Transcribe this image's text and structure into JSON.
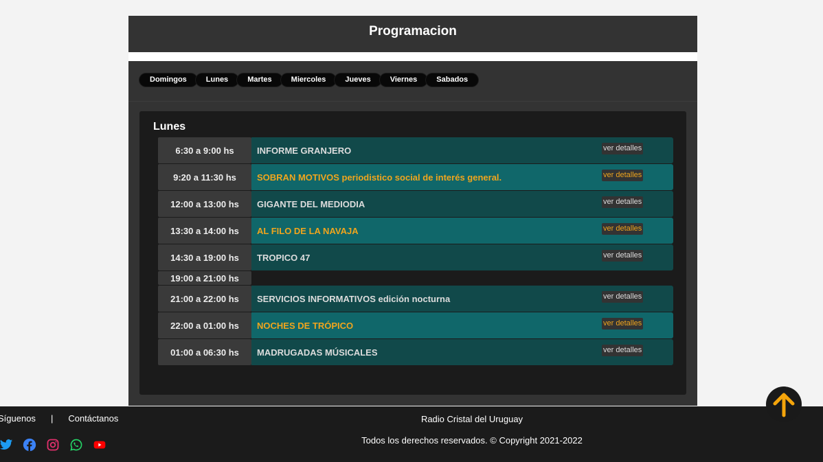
{
  "header": {
    "title": "Programacion"
  },
  "tabs": [
    {
      "label": "Domingos"
    },
    {
      "label": "Lunes"
    },
    {
      "label": "Martes"
    },
    {
      "label": "Miercoles"
    },
    {
      "label": "Jueves"
    },
    {
      "label": "Viernes"
    },
    {
      "label": "Sabados"
    }
  ],
  "day": {
    "title": "Lunes",
    "details_label": "ver detalles",
    "rows": [
      {
        "time": "6:30 a 9:00 hs",
        "program": "INFORME GRANJERO"
      },
      {
        "time": "9:20 a 11:30 hs",
        "program": "SOBRAN MOTIVOS periodistico social de interés general."
      },
      {
        "time": "12:00 a 13:00 hs",
        "program": "GIGANTE DEL MEDIODIA"
      },
      {
        "time": "13:30 a 14:00 hs",
        "program": "AL FILO DE LA NAVAJA"
      },
      {
        "time": "14:30 a 19:00 hs",
        "program": "TROPICO 47"
      },
      {
        "time": "19:00 a 21:00 hs",
        "program": ""
      },
      {
        "time": "21:00 a 22:00 hs",
        "program": "SERVICIOS INFORMATIVOS edición nocturna"
      },
      {
        "time": "22:00 a 01:00 hs",
        "program": "NOCHES DE TRÓPICO"
      },
      {
        "time": "01:00 a 06:30 hs",
        "program": "MADRUGADAS MÚSICALES"
      }
    ]
  },
  "footer": {
    "link_follow": "Síguenos",
    "separator": "|",
    "link_contact": "Contáctanos",
    "brand": "Radio Cristal del Uruguay",
    "copyright": "Todos los derechos reservados. © Copyright 2021-2022",
    "social_icons": [
      "twitter-icon",
      "facebook-icon",
      "instagram-icon",
      "whatsapp-icon",
      "youtube-icon"
    ]
  },
  "colors": {
    "accent": "#f0a51d",
    "row_dark": "#11494a",
    "row_light": "#10676a",
    "footer_bg": "#1b1b1b"
  }
}
